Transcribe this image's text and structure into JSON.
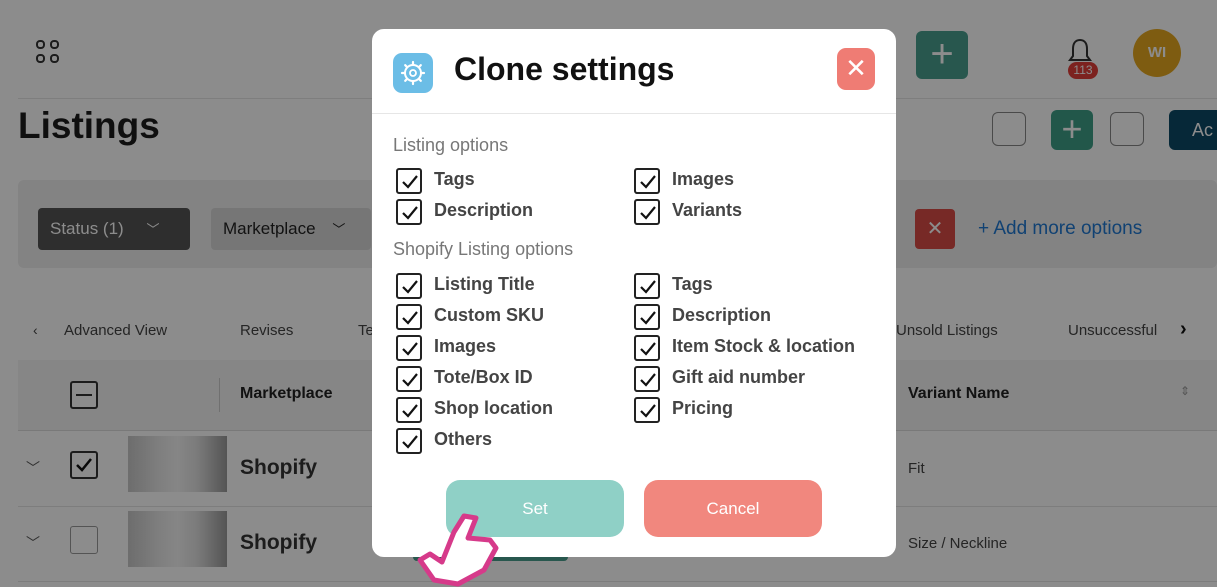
{
  "app": {
    "page_title": "Listings",
    "notifications_count": "113",
    "avatar_initials": "WI",
    "add_button_label": "Ac",
    "filters": {
      "status_label": "Status (1)",
      "marketplace_label": "Marketplace",
      "add_more_label": "+ Add more options"
    },
    "tabs": [
      "Advanced View",
      "Revises",
      "Te",
      "Unsold Listings",
      "Unsuccessful"
    ],
    "table": {
      "col_marketplace": "Marketplace",
      "col_variant": "Variant Name",
      "rows": [
        {
          "marketplace": "Shopify",
          "variant": "Fit",
          "checked": true
        },
        {
          "marketplace": "Shopify",
          "variant": "Size / Neckline",
          "checked": false
        }
      ]
    }
  },
  "modal": {
    "title": "Clone settings",
    "listing_options_title": "Listing options",
    "listing_options": [
      {
        "label": "Tags",
        "checked": true
      },
      {
        "label": "Images",
        "checked": true
      },
      {
        "label": "Description",
        "checked": true
      },
      {
        "label": "Variants",
        "checked": true
      }
    ],
    "shopify_options_title": "Shopify Listing options",
    "shopify_options": [
      {
        "label": "Listing Title",
        "checked": true
      },
      {
        "label": "Tags",
        "checked": true
      },
      {
        "label": "Custom SKU",
        "checked": true
      },
      {
        "label": "Description",
        "checked": true
      },
      {
        "label": "Images",
        "checked": true
      },
      {
        "label": "Item Stock & location",
        "checked": true
      },
      {
        "label": "Tote/Box ID",
        "checked": true
      },
      {
        "label": "Gift aid number",
        "checked": true
      },
      {
        "label": "Shop location",
        "checked": true
      },
      {
        "label": "Pricing",
        "checked": true
      },
      {
        "label": "Others",
        "checked": true
      }
    ],
    "set_label": "Set",
    "cancel_label": "Cancel"
  },
  "colors": {
    "accent_teal": "#8fd0c6",
    "cancel_red": "#f1877e",
    "close_red": "#ef7c74",
    "gear_blue": "#6bbde6",
    "pointer_pink": "#d63a8a"
  }
}
